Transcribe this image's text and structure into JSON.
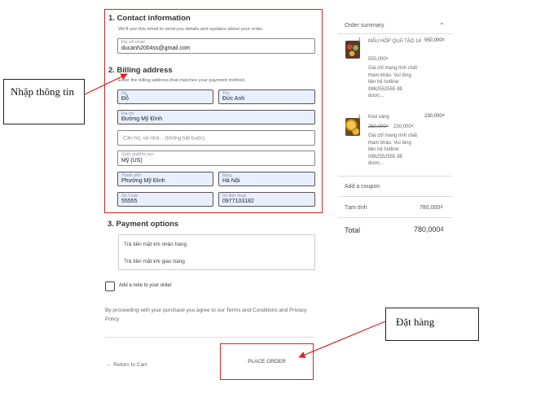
{
  "contact": {
    "heading": "1.  Contact information",
    "description": "We'll use this email to send you details and updates about your order.",
    "email_label": "Địa chỉ email",
    "email_value": "ducanh2004ss@gmail.com"
  },
  "billing": {
    "heading": "2.  Billing address",
    "description": "Enter the billing address that matches your payment method.",
    "last_name_label": "Họ",
    "last_name_value": "Đỗ",
    "first_name_label": "Tên",
    "first_name_value": "Đức Anh",
    "address_label": "Địa chỉ",
    "address_value": "Đường Mỹ Đình",
    "apartment_placeholder": "Căn hộ, số nhà... (không bắt buộc)",
    "country_label": "Quốc gia/Khu vực",
    "country_value": "Mỹ (US)",
    "city_label": "Thành phố",
    "city_value": "Phường Mỹ Đình",
    "state_label": "Bang",
    "state_value": "Hà Nội",
    "zip_label": "Zip Code",
    "zip_value": "55555",
    "phone_label": "Số điện thoại",
    "phone_value": "0977103182"
  },
  "payment": {
    "heading": "3.  Payment options",
    "options": [
      "Trả tiền mặt khi nhận hàng",
      "Trả tiền mặt khi giao hàng"
    ]
  },
  "note_label": "Add a note to your order",
  "terms": "By proceeding with your purchase you agree to our Terms and Conditions and Privacy Policy",
  "return_label": "← Return to Cart",
  "place_order_label": "PLACE ORDER",
  "summary": {
    "title": "Order summary",
    "items": [
      {
        "qty": "1",
        "name": "MÂU HỘP QUÀ TẶO 14",
        "total": "550,000₫",
        "price": "550,000₫",
        "note": [
          "Giá chỉ mang tính chất",
          "tham khảo. Vui lòng",
          "liên hệ hotline:",
          "0862552555 để",
          "dược..."
        ]
      },
      {
        "qty": "1",
        "name": "Kiwi vàng",
        "total": "230,000₫",
        "old_price": "250,000₫",
        "price": "230,000₫",
        "note": [
          "Giá chỉ mang tính chất",
          "tham khảo. Vui lòng",
          "liên hệ hotline:",
          "0862552555 để",
          "dược..."
        ]
      }
    ],
    "coupon_label": "Add a coupon",
    "subtotal_label": "Tạm tính",
    "subtotal_value": "780,000₫",
    "total_label": "Total",
    "total_value": "780,000₫"
  },
  "callouts": {
    "input": "Nhập thông tin",
    "order": "Đặt hàng"
  },
  "colors": {
    "highlight": "#dd2222",
    "field_fill": "#e9efff"
  }
}
